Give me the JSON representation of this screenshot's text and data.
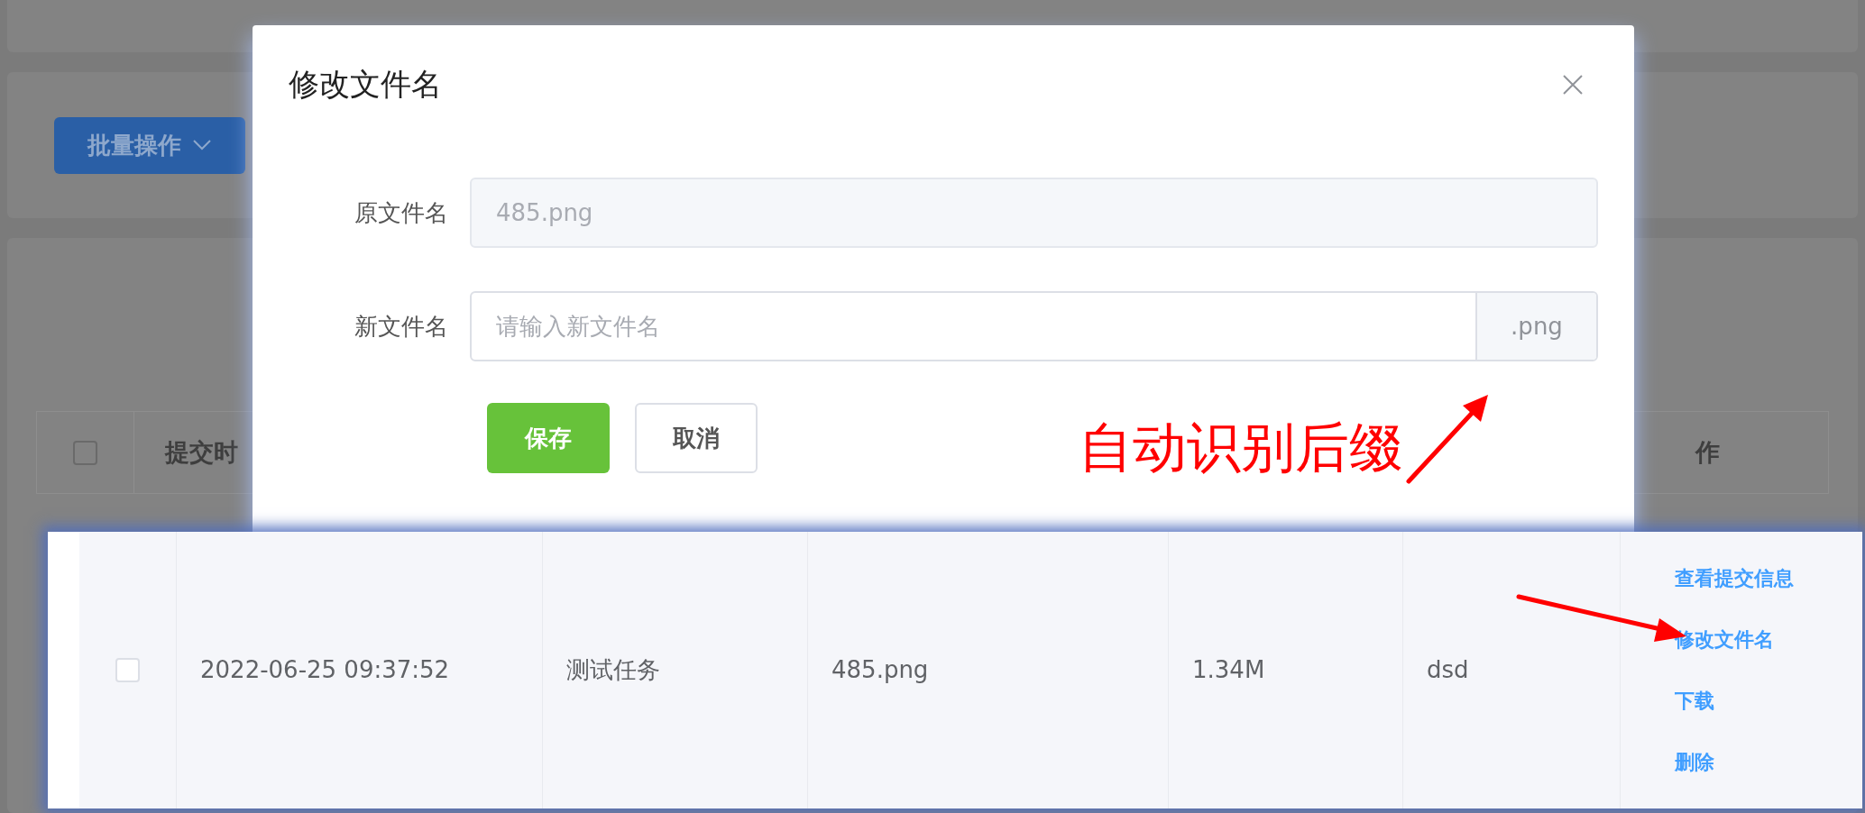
{
  "page": {
    "batch_button": "批量操作",
    "table_header": {
      "checked": false,
      "columns": [
        "提交时",
        "作"
      ]
    }
  },
  "dialog": {
    "title": "修改文件名",
    "fields": [
      {
        "kind": "readonly",
        "label": "原文件名",
        "value": "485.png"
      },
      {
        "kind": "suffix",
        "label": "新文件名",
        "placeholder": "请输入新文件名",
        "suffix": ".png"
      }
    ],
    "buttons": [
      {
        "kind": "primary",
        "label": "保存"
      },
      {
        "kind": "default",
        "label": "取消"
      }
    ]
  },
  "annotation": {
    "text": "自动识别后缀"
  },
  "highlighted_row": {
    "checked": false,
    "cells": [
      "2022-06-25 09:37:52",
      "测试任务",
      "485.png",
      "1.34M",
      "dsd"
    ],
    "actions": [
      "查看提交信息",
      "修改文件名",
      "下载",
      "删除"
    ]
  }
}
